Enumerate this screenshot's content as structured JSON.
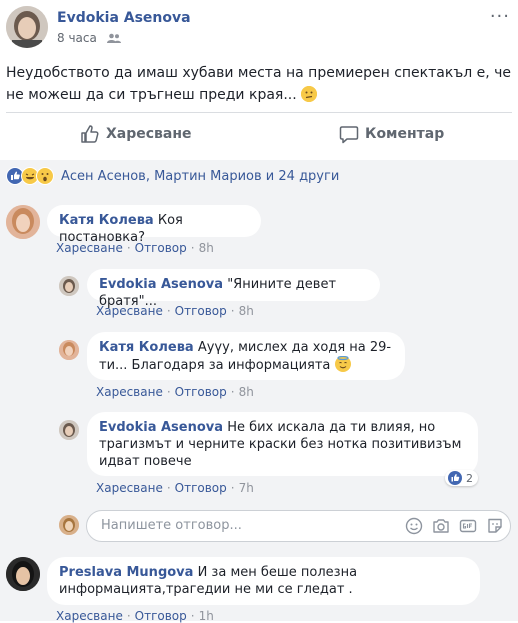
{
  "post": {
    "author": "Evdokia Asenova",
    "time": "8 часа",
    "text": "Неудобството да имаш хубави места на премиерен спектакъл е, че не можеш да си тръгнеш преди края...",
    "more": "···"
  },
  "actions": {
    "like_label": "Харесване",
    "comment_label": "Коментар"
  },
  "reactions": {
    "summary": "Асен Асенов, Мартин Мариов и 24 други"
  },
  "comments": [
    {
      "name": "Катя Колева",
      "text": "Коя постановка?",
      "like": "Харесване",
      "reply": "Отговор",
      "time": "8h"
    },
    {
      "name": "Evdokia Asenova",
      "text": "\"Янините девет братя\"...",
      "like": "Харесване",
      "reply": "Отговор",
      "time": "8h"
    },
    {
      "name": "Катя Колева",
      "text": "Ауүу, мислех да ходя на 29-ти... Благодаря за информацията",
      "like": "Харесване",
      "reply": "Отговор",
      "time": "8h"
    },
    {
      "name": "Evdokia Asenova",
      "text": "Не бих искала да ти влияя, но трагизмът и черните краски без нотка позитивизъм идват повече",
      "like": "Харесване",
      "reply": "Отговор",
      "time": "7h",
      "like_count": "2"
    },
    {
      "name": "Preslava Mungova",
      "text": "И за мен беше полезна информацията,трагедии не ми се гледат .",
      "like": "Харесване",
      "reply": "Отговор",
      "time": "1h"
    }
  ],
  "reply_box": {
    "placeholder": "Напишете отговор..."
  },
  "colors": {
    "link_blue": "#385898",
    "comments_bg": "#f2f3f5",
    "like_blue": "#4267b2"
  }
}
